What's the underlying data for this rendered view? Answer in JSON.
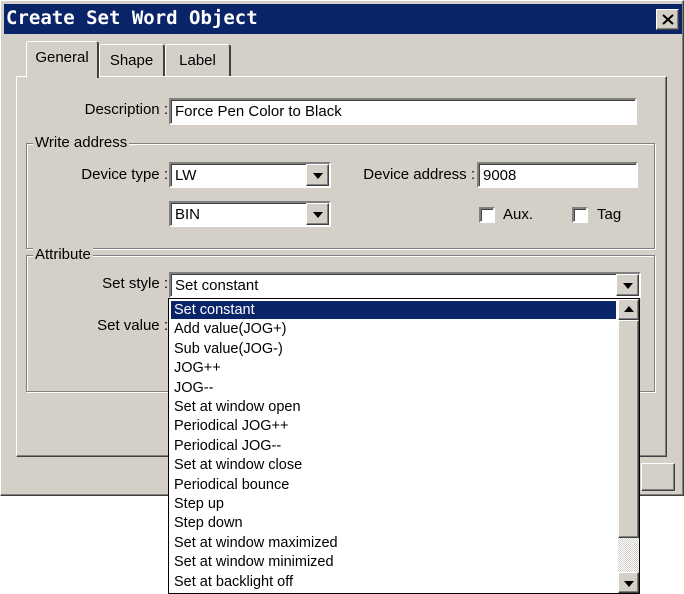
{
  "window": {
    "title": "Create Set Word  Object"
  },
  "tabs": [
    {
      "label": "General"
    },
    {
      "label": "Shape"
    },
    {
      "label": "Label"
    }
  ],
  "general": {
    "description_label": "Description :",
    "description_value": "Force Pen Color to Black",
    "write_address": {
      "title": "Write address",
      "device_type_label": "Device type :",
      "device_type_value": "LW",
      "device_address_label": "Device address :",
      "device_address_value": "9008",
      "format_value": "BIN",
      "aux_label": "Aux.",
      "aux_checked": false,
      "tag_label": "Tag",
      "tag_checked": false
    },
    "attribute": {
      "title": "Attribute",
      "set_style_label": "Set style :",
      "set_style_value": "Set constant",
      "set_value_label": "Set value :"
    }
  },
  "set_style_dropdown": {
    "selected": "Set constant",
    "options": [
      "Set constant",
      "Add value(JOG+)",
      "Sub value(JOG-)",
      "JOG++",
      "JOG--",
      "Set at window open",
      "Periodical JOG++",
      "Periodical JOG--",
      "Set at window close",
      "Periodical bounce",
      "Step up",
      "Step down",
      "Set at window maximized",
      "Set at window minimized",
      "Set at backlight off"
    ]
  },
  "colors": {
    "titlebar": "#0a246a",
    "face": "#d4d0c8",
    "selection": "#0a246a"
  },
  "icons": [
    "close-icon",
    "chevron-down-icon",
    "chevron-up-icon"
  ]
}
